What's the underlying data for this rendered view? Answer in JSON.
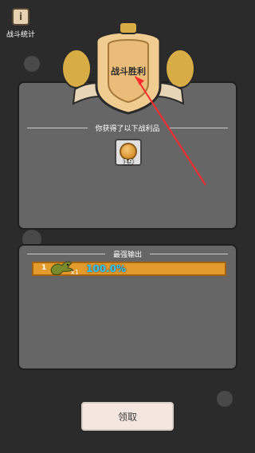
{
  "stats": {
    "icon": "i",
    "label": "战斗统计"
  },
  "badge": {
    "title": "战斗胜利"
  },
  "reward": {
    "title": "你获得了以下战利品",
    "items": [
      {
        "icon": "coin-icon",
        "count": "19"
      }
    ]
  },
  "damage": {
    "title": "最强输出",
    "rows": [
      {
        "rank": "1",
        "multiplier": "x1",
        "percent": "100.0%"
      }
    ]
  },
  "button": {
    "claim_label": "领取"
  },
  "colors": {
    "accent": "#e39b2b",
    "panel": "#666666",
    "highlight": "#2ec7ff"
  }
}
